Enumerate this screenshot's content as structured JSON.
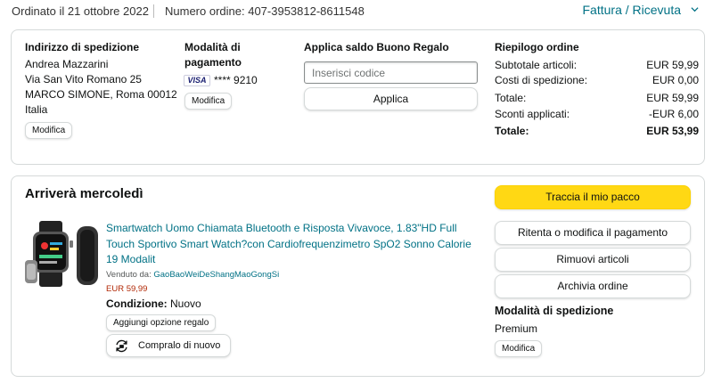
{
  "header": {
    "order_date": "Ordinato il 21 ottobre 2022",
    "order_number": "Numero ordine: 407-3953812-8611548",
    "invoice_link": "Fattura / Ricevuta"
  },
  "shipping_address": {
    "title": "Indirizzo di spedizione",
    "lines": [
      "Andrea Mazzarini",
      "Via San Vito Romano 25",
      "MARCO SIMONE, Roma 00012",
      "Italia"
    ],
    "edit_label": "Modifica"
  },
  "payment": {
    "title_line1": "Modalità di",
    "title_line2": "pagamento",
    "card_brand": "VISA",
    "card_number": "**** 9210",
    "edit_label": "Modifica"
  },
  "gift_card": {
    "title": "Applica saldo Buono Regalo",
    "placeholder": "Inserisci codice",
    "apply_label": "Applica"
  },
  "summary": {
    "title": "Riepilogo ordine",
    "rows": [
      {
        "label": "Subtotale articoli:",
        "value": "EUR 59,99"
      },
      {
        "label": "Costi di spedizione:",
        "value": "EUR 0,00"
      },
      {
        "label": "Totale:",
        "value": "EUR 59,99"
      },
      {
        "label": "Sconti applicati:",
        "value": "-EUR 6,00"
      },
      {
        "label": "Totale:",
        "value": "EUR 53,99"
      }
    ]
  },
  "shipment": {
    "arrival": "Arriverà mercoledì",
    "product_title": "Smartwatch Uomo Chiamata Bluetooth e Risposta Vivavoce, 1.83\"HD Full Touch Sportivo Smart Watch?con Cardiofrequenzimetro SpO2 Sonno Calorie 19 Modalit",
    "sold_by_prefix": "Venduto da: ",
    "seller": "GaoBaoWeiDeShangMaoGongSi",
    "price": "EUR 59,99",
    "condition_label": "Condizione:",
    "condition_value": "Nuovo",
    "gift_option_label": "Aggiungi opzione regalo",
    "rebuy_label": "Compralo di nuovo"
  },
  "actions": {
    "track": "Traccia il mio pacco",
    "retry_payment": "Ritenta o modifica il pagamento",
    "remove_items": "Rimuovi articoli",
    "archive": "Archivia ordine"
  },
  "shipping_method": {
    "title": "Modalità di spedizione",
    "value": "Premium",
    "edit_label": "Modifica"
  },
  "colors": {
    "link": "#007185",
    "track_button": "#ffd814",
    "price": "#b12704",
    "border": "#d5d9d9"
  }
}
